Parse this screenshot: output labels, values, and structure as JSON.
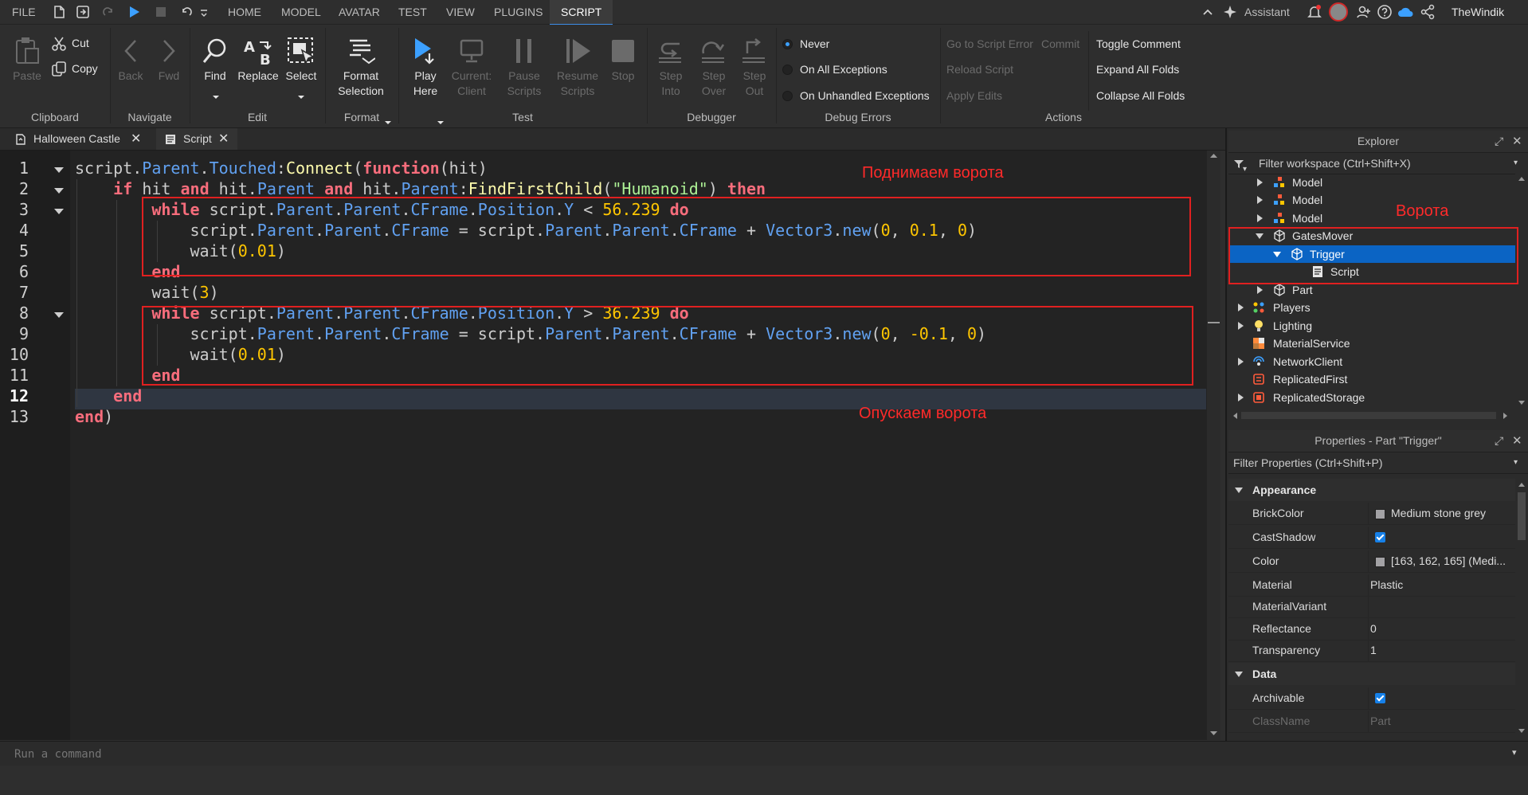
{
  "menubar": {
    "file": "FILE",
    "tabs": [
      "HOME",
      "MODEL",
      "AVATAR",
      "TEST",
      "VIEW",
      "PLUGINS",
      "SCRIPT"
    ],
    "active_tab": "SCRIPT",
    "assistant": "Assistant",
    "username": "TheWindik"
  },
  "ribbon": {
    "clipboard": {
      "paste": "Paste",
      "cut": "Cut",
      "copy": "Copy",
      "group": "Clipboard"
    },
    "navigate": {
      "back": "Back",
      "fwd": "Fwd",
      "group": "Navigate"
    },
    "edit": {
      "find": "Find",
      "replace": "Replace",
      "select": "Select",
      "group": "Edit"
    },
    "format": {
      "line1": "Format",
      "line2": "Selection",
      "group": "Format"
    },
    "test": {
      "play1": "Play",
      "play2": "Here",
      "client1": "Current:",
      "client2": "Client",
      "pause1": "Pause",
      "pause2": "Scripts",
      "resume1": "Resume",
      "resume2": "Scripts",
      "stop": "Stop",
      "group": "Test"
    },
    "debugger": {
      "into1": "Step",
      "into2": "Into",
      "over1": "Step",
      "over2": "Over",
      "out1": "Step",
      "out2": "Out",
      "group": "Debugger"
    },
    "debug_errors": {
      "never": "Never",
      "all": "On All Exceptions",
      "unhandled": "On Unhandled Exceptions",
      "group": "Debug Errors",
      "selected": "Never"
    },
    "actions": {
      "goto": "Go to Script Error",
      "commit": "Commit",
      "reload": "Reload Script",
      "apply": "Apply Edits",
      "toggle": "Toggle Comment",
      "expand": "Expand All Folds",
      "collapse": "Collapse All Folds",
      "group": "Actions"
    }
  },
  "tabs": [
    {
      "label": "Halloween Castle"
    },
    {
      "label": "Script",
      "active": true
    }
  ],
  "editor": {
    "line_numbers": [
      "1",
      "2",
      "3",
      "4",
      "5",
      "6",
      "7",
      "8",
      "9",
      "10",
      "11",
      "12",
      "13"
    ],
    "current_line": 12,
    "annotations": {
      "top": "Поднимаем ворота",
      "bottom": "Опускаем ворота"
    }
  },
  "command_bar": {
    "placeholder": "Run a command"
  },
  "explorer": {
    "title": "Explorer",
    "filter": "Filter workspace (Ctrl+Shift+X)",
    "annotation": "Ворота",
    "items": [
      {
        "label": "Model",
        "icon": "model-icon"
      },
      {
        "label": "Model",
        "icon": "model-icon"
      },
      {
        "label": "Model",
        "icon": "model-icon"
      },
      {
        "label": "GatesMover",
        "icon": "part-icon"
      },
      {
        "label": "Trigger",
        "icon": "part-icon",
        "selected": true
      },
      {
        "label": "Script",
        "icon": "script-icon"
      },
      {
        "label": "Part",
        "icon": "part-icon"
      },
      {
        "label": "Players",
        "icon": "players-icon"
      },
      {
        "label": "Lighting",
        "icon": "lighting-icon"
      },
      {
        "label": "MaterialService",
        "icon": "material-service-icon"
      },
      {
        "label": "NetworkClient",
        "icon": "network-client-icon"
      },
      {
        "label": "ReplicatedFirst",
        "icon": "replicated-first-icon"
      },
      {
        "label": "ReplicatedStorage",
        "icon": "replicated-storage-icon"
      }
    ]
  },
  "properties": {
    "title": "Properties - Part \"Trigger\"",
    "filter": "Filter Properties (Ctrl+Shift+P)",
    "appearance": "Appearance",
    "data": "Data",
    "rows": [
      {
        "name": "BrickColor",
        "value": "Medium stone grey"
      },
      {
        "name": "CastShadow",
        "value": true
      },
      {
        "name": "Color",
        "value": "[163, 162, 165] (Medi..."
      },
      {
        "name": "Material",
        "value": "Plastic"
      },
      {
        "name": "MaterialVariant",
        "value": ""
      },
      {
        "name": "Reflectance",
        "value": "0"
      },
      {
        "name": "Transparency",
        "value": "1"
      }
    ],
    "data_rows": [
      {
        "name": "Archivable",
        "value": true
      },
      {
        "name": "ClassName",
        "value": "Part"
      }
    ]
  },
  "colors": {
    "accent": "#0b64c4",
    "keyword": "#f86d7c",
    "property": "#61a1f1",
    "number": "#ffc600",
    "string": "#adf195",
    "function": "#fdfbac",
    "annotation": "#e02020"
  }
}
